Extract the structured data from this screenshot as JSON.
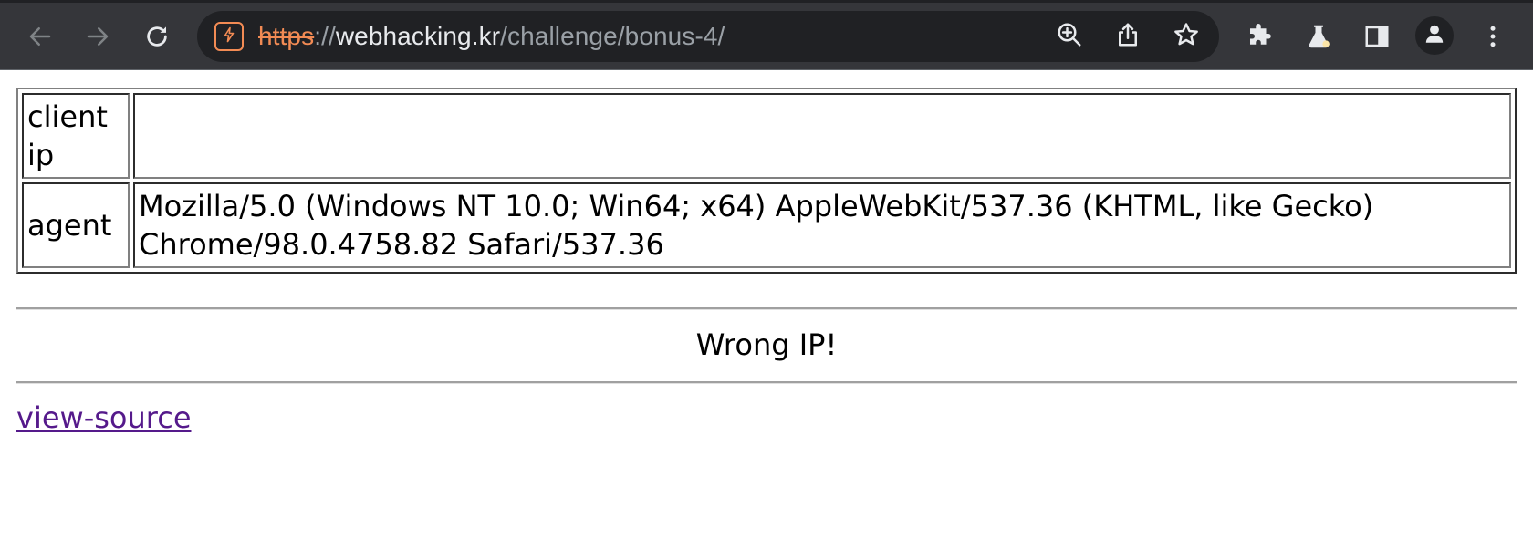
{
  "browser": {
    "url": {
      "scheme": "https",
      "separator": "://",
      "host": "webhacking.kr",
      "path": "/challenge/bonus-4/"
    },
    "colors": {
      "toolbar": "#35363a",
      "omnibox": "#202124",
      "insecure_accent": "#f28b54"
    },
    "icons": {
      "back": "arrow-left-icon",
      "forward": "arrow-right-icon",
      "reload": "reload-icon",
      "site_info": "not-secure-icon",
      "zoom": "zoom-in-icon",
      "share": "share-icon",
      "bookmark": "star-icon",
      "extensions": "puzzle-icon",
      "labs": "flask-icon",
      "side_panel": "side-panel-icon",
      "profile": "profile-icon",
      "menu": "kebab-menu-icon"
    }
  },
  "page": {
    "table": [
      {
        "key": "client ip",
        "value": ""
      },
      {
        "key": "agent",
        "value": "Mozilla/5.0 (Windows NT 10.0; Win64; x64) AppleWebKit/537.36 (KHTML, like Gecko) Chrome/98.0.4758.82 Safari/537.36"
      }
    ],
    "message": "Wrong IP!",
    "link_text": "view-source",
    "colors": {
      "link_visited": "#551a8b"
    }
  }
}
